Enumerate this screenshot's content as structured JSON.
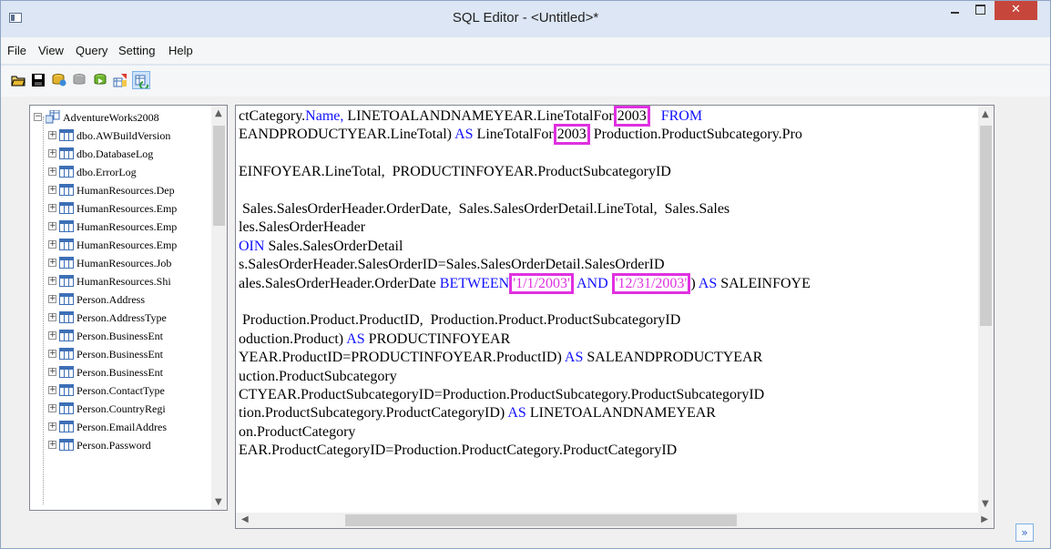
{
  "window": {
    "title": "SQL Editor - <Untitled>*",
    "close_glyph": "✕"
  },
  "menu": [
    "File",
    "View",
    "Query",
    "Setting",
    "Help"
  ],
  "toolbar": {
    "icons": [
      "open-folder-icon",
      "save-icon",
      "connect-database-icon",
      "disconnect-icon",
      "run-query-icon",
      "import-data-icon",
      "refresh-icon"
    ],
    "active_index": 6
  },
  "tree": {
    "root": "AdventureWorks2008",
    "items": [
      "dbo.AWBuildVersion",
      "dbo.DatabaseLog",
      "dbo.ErrorLog",
      "HumanResources.Dep",
      "HumanResources.Emp",
      "HumanResources.Emp",
      "HumanResources.Emp",
      "HumanResources.Job",
      "HumanResources.Shi",
      "Person.Address",
      "Person.AddressType",
      "Person.BusinessEnt",
      "Person.BusinessEnt",
      "Person.BusinessEnt",
      "Person.ContactType",
      "Person.CountryRegi",
      "Person.EmailAddres",
      "Person.Password"
    ]
  },
  "editor": {
    "lines": [
      {
        "t": "ctCategory.",
        "k1": "Name,",
        "t2": " LINETOALANDNAMEYEAR.LineTotalFor",
        "h1": "2003",
        "t3": "   ",
        "k2": "FROM",
        "t4": ""
      },
      {
        "t": "EANDPRODUCTYEAR.LineTotal)",
        "k1": " AS",
        "t2": " LineTotalFor",
        "h1": "2003",
        "t3": " Production.ProductSubcategory.Pro",
        "k2": "",
        "t4": ""
      },
      {
        "t": "",
        "k1": "",
        "t2": "",
        "h1": "",
        "t3": "",
        "k2": "",
        "t4": ""
      },
      {
        "t": "EINFOYEAR.LineTotal,  PRODUCTINFOYEAR.ProductSubcategoryID",
        "k1": "",
        "t2": "",
        "h1": "",
        "t3": "",
        "k2": "",
        "t4": ""
      },
      {
        "t": "",
        "k1": "",
        "t2": "",
        "h1": "",
        "t3": "",
        "k2": "",
        "t4": ""
      },
      {
        "t": " Sales.SalesOrderHeader.OrderDate,  Sales.SalesOrderDetail.LineTotal,  Sales.Sales",
        "k1": "",
        "t2": "",
        "h1": "",
        "t3": "",
        "k2": "",
        "t4": ""
      },
      {
        "t": "les.SalesOrderHeader",
        "k1": "",
        "t2": "",
        "h1": "",
        "t3": "",
        "k2": "",
        "t4": ""
      },
      {
        "t": "",
        "k1": "OIN",
        "t2": " Sales.SalesOrderDetail",
        "h1": "",
        "t3": "",
        "k2": "",
        "t4": ""
      },
      {
        "t": "s.SalesOrderHeader.SalesOrderID=Sales.SalesOrderDetail.SalesOrderID",
        "k1": "",
        "t2": "",
        "h1": "",
        "t3": "",
        "k2": "",
        "t4": ""
      },
      {
        "t": "ales.SalesOrderHeader.OrderDate",
        "k1": " BETWEEN",
        "t2": "",
        "h1": "'1/1/2003'",
        "t3": " ",
        "k2": "AND",
        "t4": " ",
        "h2": "'12/31/2003'",
        "t5": ")",
        "k3": " AS",
        "t6": " SALEINFOYE"
      },
      {
        "t": "",
        "k1": "",
        "t2": "",
        "h1": "",
        "t3": "",
        "k2": "",
        "t4": ""
      },
      {
        "t": " Production.Product.ProductID,  Production.Product.ProductSubcategoryID",
        "k1": "",
        "t2": "",
        "h1": "",
        "t3": "",
        "k2": "",
        "t4": ""
      },
      {
        "t": "oduction.Product)",
        "k1": " AS",
        "t2": " PRODUCTINFOYEAR",
        "h1": "",
        "t3": "",
        "k2": "",
        "t4": ""
      },
      {
        "t": "YEAR.ProductID=PRODUCTINFOYEAR.ProductID)",
        "k1": " AS",
        "t2": " SALEANDPRODUCTYEAR",
        "h1": "",
        "t3": "",
        "k2": "",
        "t4": ""
      },
      {
        "t": "uction.ProductSubcategory",
        "k1": "",
        "t2": "",
        "h1": "",
        "t3": "",
        "k2": "",
        "t4": ""
      },
      {
        "t": "CTYEAR.ProductSubcategoryID=Production.ProductSubcategory.ProductSubcategoryID",
        "k1": "",
        "t2": "",
        "h1": "",
        "t3": "",
        "k2": "",
        "t4": ""
      },
      {
        "t": "tion.ProductSubcategory.ProductCategoryID)",
        "k1": " AS",
        "t2": " LINETOALANDNAMEYEAR",
        "h1": "",
        "t3": "",
        "k2": "",
        "t4": ""
      },
      {
        "t": "on.ProductCategory",
        "k1": "",
        "t2": "",
        "h1": "",
        "t3": "",
        "k2": "",
        "t4": ""
      },
      {
        "t": "EAR.ProductCategoryID=Production.ProductCategory.ProductCategoryID",
        "k1": "",
        "t2": "",
        "h1": "",
        "t3": "",
        "k2": "",
        "t4": ""
      }
    ]
  },
  "colors": {
    "keyword": "#1010ff",
    "highlight": "#e030e0",
    "close_button": "#c7463c"
  },
  "corner_button_glyph": "»"
}
